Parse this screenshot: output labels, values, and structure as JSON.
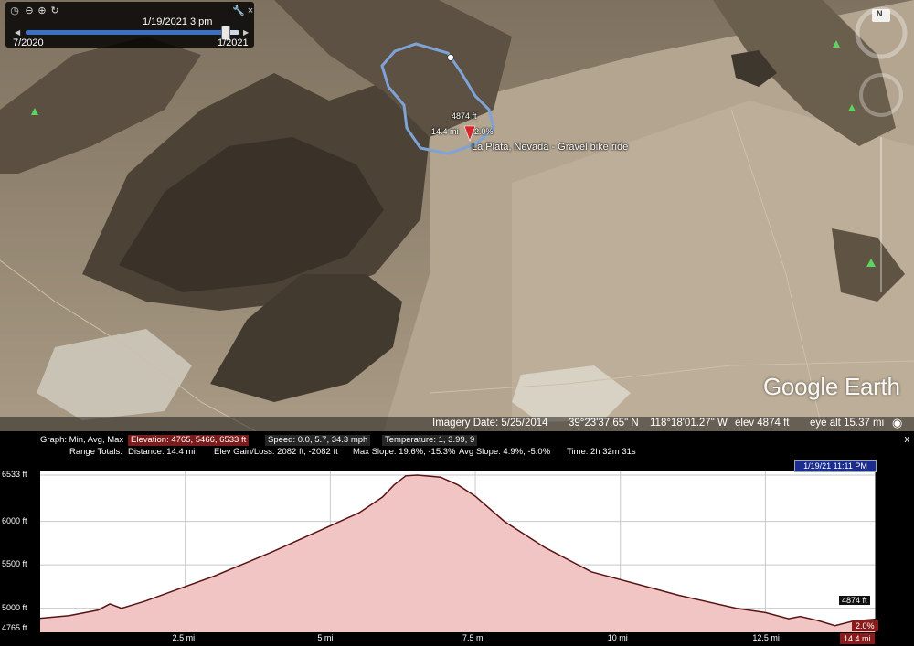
{
  "time_slider": {
    "current": "1/19/2021   3 pm",
    "start": "7/2020",
    "end": "1/2021",
    "position_fraction": 0.93
  },
  "map": {
    "placemark": {
      "title": "La Plata, Nevada - Gravel bike ride",
      "elevation_label": "4874 ft",
      "distance_label": "14.4 mi",
      "slope_label": "2.0%"
    },
    "logo": "Google Earth",
    "compass_north": "N"
  },
  "status_bar": {
    "imagery_date": "Imagery Date: 5/25/2014",
    "latitude": "39°23'37.65\" N",
    "longitude": "118°18'01.27\" W",
    "elevation": "elev  4874 ft",
    "eye_alt": "eye alt  15.37 mi"
  },
  "profile": {
    "graph_label": "Graph: Min, Avg, Max",
    "elevation_stat": "Elevation: 4765, 5466, 6533 ft",
    "speed_stat": "Speed: 0.0, 5.7, 34.3 mph",
    "temperature_stat": "Temperature: 1, 3.99, 9",
    "range_label": "Range Totals:",
    "distance_stat": "Distance: 14.4 mi",
    "elev_gain_stat": "Elev Gain/Loss: 2082 ft, -2082 ft",
    "max_slope_stat": "Max Slope: 19.6%, -15.3%",
    "avg_slope_stat": "Avg Slope: 4.9%, -5.0%",
    "time_stat": "Time: 2h 32m 31s",
    "cursor_time": "1/19/21 11:11 PM",
    "cursor_elevation": "4874 ft",
    "cursor_slope": "2.0%",
    "cursor_distance": "14.4 mi",
    "close": "x"
  },
  "chart_data": {
    "type": "area",
    "x_unit": "mi",
    "y_unit": "ft",
    "xlim": [
      0,
      14.4
    ],
    "ylim": [
      4765,
      6533
    ],
    "x_ticks": [
      "2.5 mi",
      "5 mi",
      "7.5 mi",
      "10 mi",
      "12.5 mi"
    ],
    "x_tick_values": [
      2.5,
      5,
      7.5,
      10,
      12.5
    ],
    "y_ticks": [
      "6533 ft",
      "6000 ft",
      "5500 ft",
      "5000 ft",
      "4765 ft"
    ],
    "y_tick_values": [
      6533,
      6000,
      5500,
      5000,
      4765
    ],
    "x": [
      0,
      0.5,
      1.0,
      1.2,
      1.4,
      1.8,
      2.5,
      3.0,
      4.0,
      5.0,
      5.5,
      5.9,
      6.1,
      6.3,
      6.5,
      6.9,
      7.2,
      7.5,
      8.0,
      8.7,
      9.5,
      10.0,
      11.0,
      12.0,
      12.5,
      12.9,
      13.1,
      13.4,
      13.7,
      14.0,
      14.4
    ],
    "y": [
      4885,
      4915,
      4980,
      5050,
      5000,
      5080,
      5250,
      5370,
      5650,
      5950,
      6100,
      6280,
      6420,
      6525,
      6533,
      6510,
      6420,
      6290,
      6000,
      5700,
      5420,
      5330,
      5150,
      5000,
      4950,
      4880,
      4905,
      4860,
      4800,
      4850,
      4874
    ],
    "grid": true
  }
}
